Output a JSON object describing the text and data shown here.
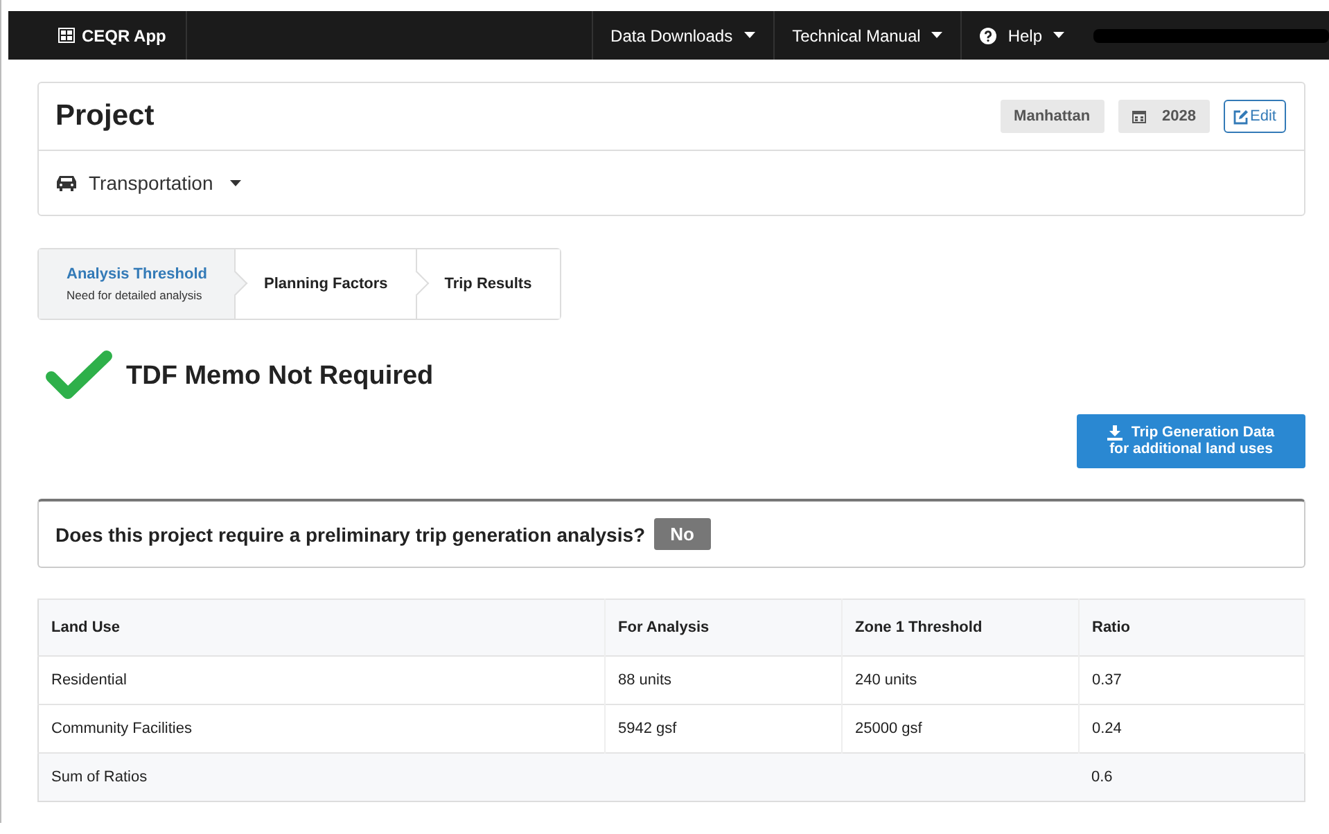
{
  "navbar": {
    "brand": "CEQR App",
    "menus": [
      {
        "label": "Data Downloads",
        "kind": "plain"
      },
      {
        "label": "Technical Manual",
        "kind": "plain"
      },
      {
        "label": "Help",
        "kind": "help"
      }
    ]
  },
  "project": {
    "title": "Project",
    "borough": "Manhattan",
    "year": "2028",
    "edit_label": "Edit",
    "chapter": "Transportation"
  },
  "steps": [
    {
      "label": "Analysis Threshold",
      "sublabel": "Need for detailed analysis",
      "selected": true
    },
    {
      "label": "Planning Factors",
      "selected": false
    },
    {
      "label": "Trip Results",
      "selected": false
    }
  ],
  "result": {
    "heading": "TDF Memo Not Required"
  },
  "download_button": {
    "line_1": "Trip Generation Data",
    "line_2": "for additional land uses"
  },
  "question": {
    "text": "Does this project require a preliminary trip generation analysis?",
    "answer": "No"
  },
  "table": {
    "columns": [
      "Land Use",
      "For Analysis",
      "Zone 1 Threshold",
      "Ratio"
    ],
    "rows": [
      [
        "Residential",
        "88 units",
        "240 units",
        "0.37"
      ],
      [
        "Community Facilities",
        "5942 gsf",
        "25000 gsf",
        "0.24"
      ]
    ],
    "footer": {
      "label": "Sum of Ratios",
      "value": "0.6"
    }
  }
}
